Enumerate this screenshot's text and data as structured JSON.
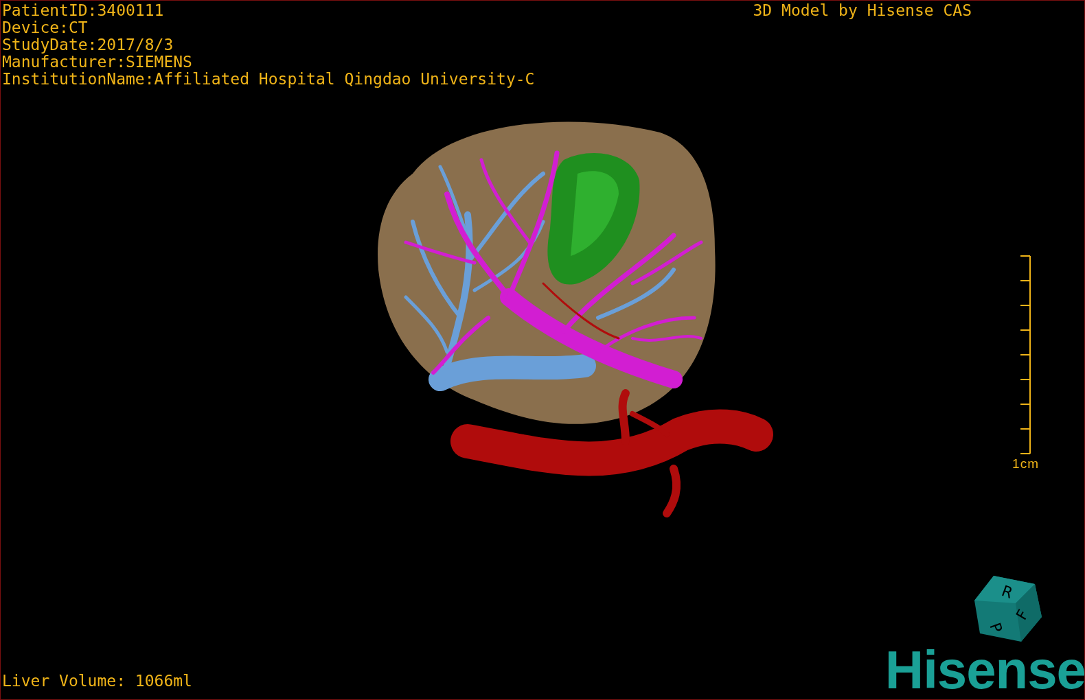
{
  "patient_info": [
    "PatientID:3400111",
    "Device:CT",
    "StudyDate:2017/8/3",
    "Manufacturer:SIEMENS",
    "InstitutionName:Affiliated Hospital Qingdao University-C"
  ],
  "title": "3D Model by Hisense CAS",
  "scale_bar": {
    "label": "1cm"
  },
  "orientation_cube": {
    "faces": [
      "R",
      "F",
      "P"
    ]
  },
  "logo": "Hisense",
  "liver_volume": "Liver Volume: 1066ml"
}
